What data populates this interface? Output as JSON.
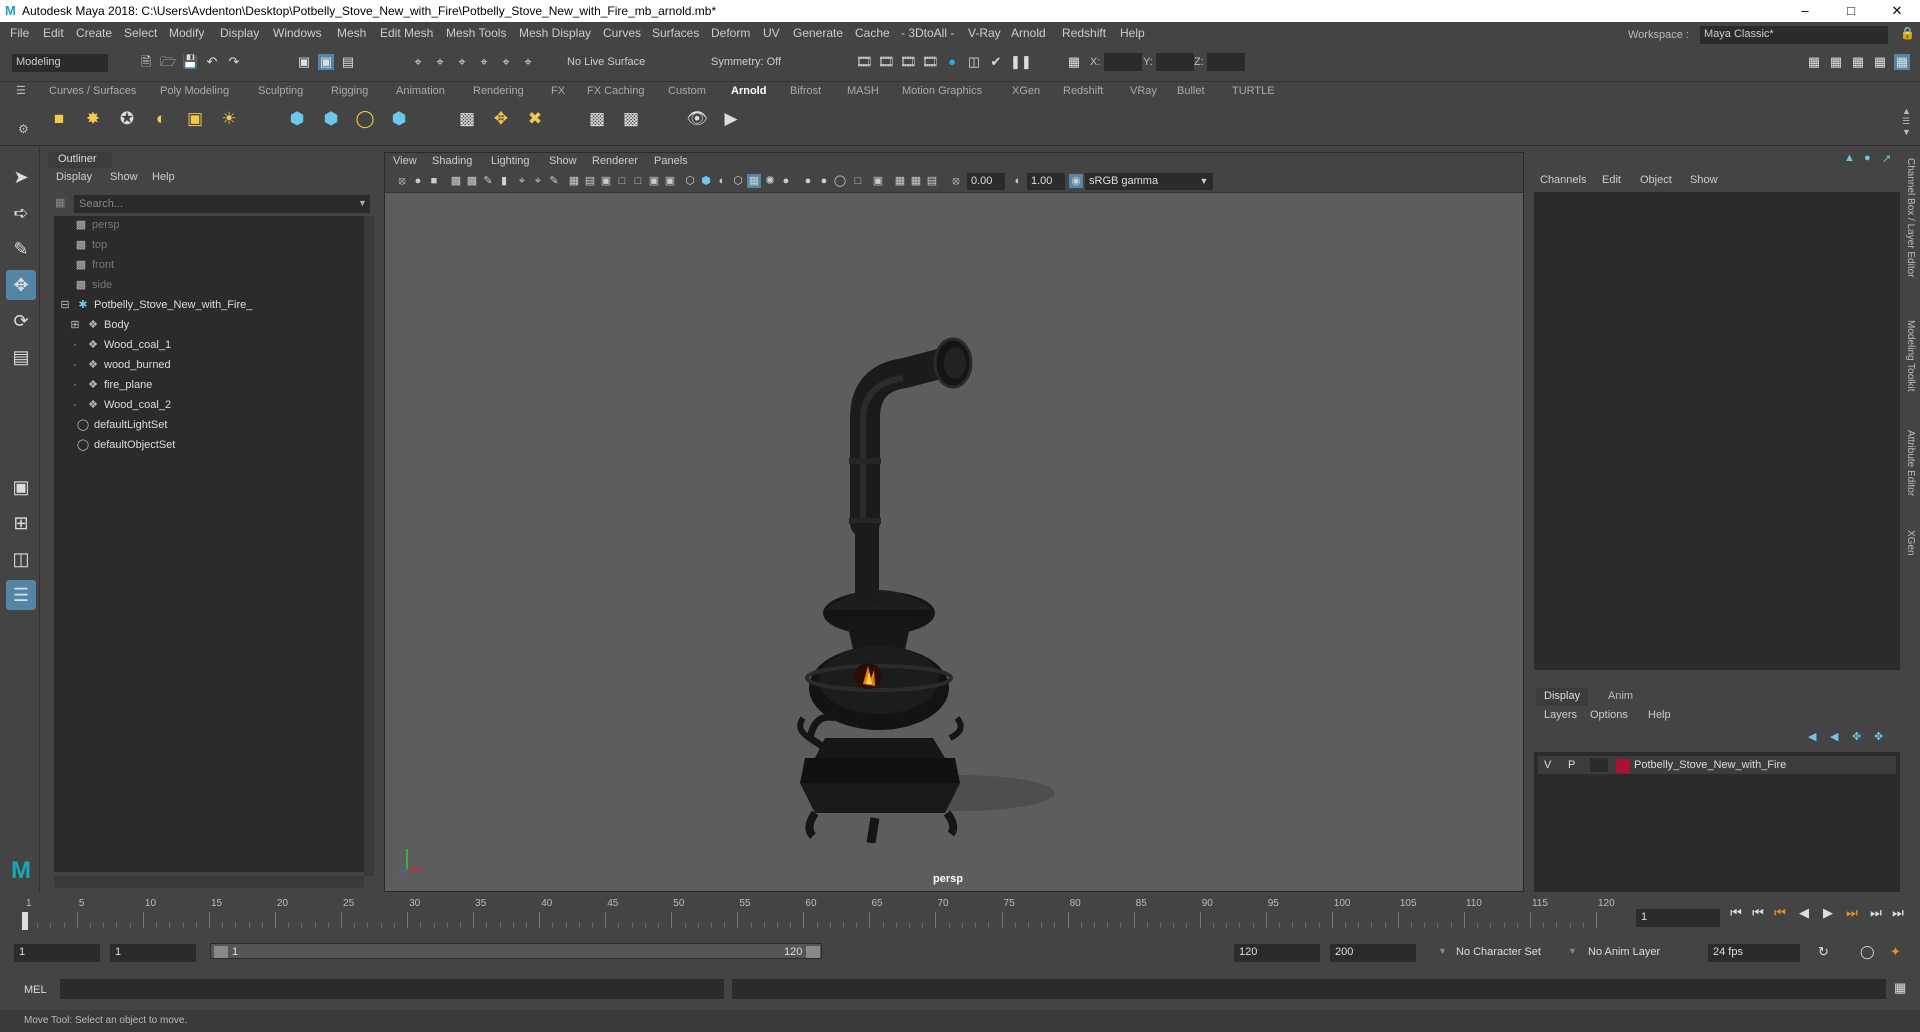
{
  "window": {
    "title": "Autodesk Maya 2018: C:\\Users\\Avdenton\\Desktop\\Potbelly_Stove_New_with_Fire\\Potbelly_Stove_New_with_Fire_mb_arnold.mb*",
    "logo_glyph": "M",
    "minimize": "–",
    "maximize": "□",
    "close": "✕"
  },
  "menubar": {
    "items": [
      "File",
      "Edit",
      "Create",
      "Select",
      "Modify",
      "Display",
      "Windows",
      "Mesh",
      "Edit Mesh",
      "Mesh Tools",
      "Mesh Display",
      "Curves",
      "Surfaces",
      "Deform",
      "UV",
      "Generate",
      "Cache",
      "- 3DtoAll -",
      "V-Ray",
      "Arnold",
      "Redshift",
      "Help"
    ],
    "workspace_label": "Workspace :",
    "workspace_value": "Maya Classic*"
  },
  "statusline": {
    "mode": "Modeling",
    "live_surface": "No Live Surface",
    "symmetry": "Symmetry: Off",
    "x_label": "X:",
    "y_label": "Y:",
    "z_label": "Z:"
  },
  "shelf": {
    "tabs": [
      "Curves / Surfaces",
      "Poly Modeling",
      "Sculpting",
      "Rigging",
      "Animation",
      "Rendering",
      "FX",
      "FX Caching",
      "Custom",
      "Arnold",
      "Bifrost",
      "MASH",
      "Motion Graphics",
      "XGen",
      "Redshift",
      "VRay",
      "Bullet",
      "TURTLE"
    ],
    "active_tab": "Arnold"
  },
  "outliner": {
    "title": "Outliner",
    "menus": [
      "Display",
      "Show",
      "Help"
    ],
    "search_placeholder": "Search...",
    "items": [
      {
        "label": "persp",
        "icon": "camera-icon",
        "dim": true
      },
      {
        "label": "top",
        "icon": "camera-icon",
        "dim": true
      },
      {
        "label": "front",
        "icon": "camera-icon",
        "dim": true
      },
      {
        "label": "side",
        "icon": "camera-icon",
        "dim": true
      },
      {
        "label": "Potbelly_Stove_New_with_Fire_",
        "icon": "group-icon",
        "dim": false
      },
      {
        "label": "Body",
        "icon": "mesh-icon",
        "dim": false
      },
      {
        "label": "Wood_coal_1",
        "icon": "mesh-icon",
        "dim": false
      },
      {
        "label": "wood_burned",
        "icon": "mesh-icon",
        "dim": false
      },
      {
        "label": "fire_plane",
        "icon": "mesh-icon",
        "dim": false
      },
      {
        "label": "Wood_coal_2",
        "icon": "mesh-icon",
        "dim": false
      },
      {
        "label": "defaultLightSet",
        "icon": "set-icon",
        "dim": false
      },
      {
        "label": "defaultObjectSet",
        "icon": "set-icon",
        "dim": false
      }
    ]
  },
  "viewport": {
    "menus": [
      "View",
      "Shading",
      "Lighting",
      "Show",
      "Renderer",
      "Panels"
    ],
    "exposure": "0.00",
    "gamma": "1.00",
    "color_space": "sRGB gamma",
    "camera_label": "persp"
  },
  "channelbox": {
    "menus": [
      "Channels",
      "Edit",
      "Object",
      "Show"
    ],
    "layer_tabs": [
      "Display",
      "Anim"
    ],
    "layer_menus": [
      "Layers",
      "Options",
      "Help"
    ],
    "layer": {
      "v": "V",
      "p": "P",
      "name": "Potbelly_Stove_New_with_Fire",
      "color": "#aa1133"
    }
  },
  "side_tabs": [
    "Channel Box / Layer Editor",
    "Modeling Toolkit",
    "Attribute Editor",
    "XGen"
  ],
  "timeslider": {
    "ticks": [
      "1",
      "5",
      "10",
      "15",
      "20",
      "25",
      "30",
      "35",
      "40",
      "45",
      "50",
      "55",
      "60",
      "65",
      "70",
      "75",
      "80",
      "85",
      "90",
      "95",
      "100",
      "105",
      "110",
      "115",
      "120"
    ],
    "current_frame": "1"
  },
  "range": {
    "start": "1",
    "playback_start": "1",
    "range_start": "1",
    "range_end": "120",
    "playback_end": "120",
    "end": "200",
    "character_set": "No Character Set",
    "anim_layer": "No Anim Layer",
    "fps": "24 fps"
  },
  "mel": {
    "label": "MEL"
  },
  "helpline": {
    "text": "Move Tool: Select an object to move."
  }
}
